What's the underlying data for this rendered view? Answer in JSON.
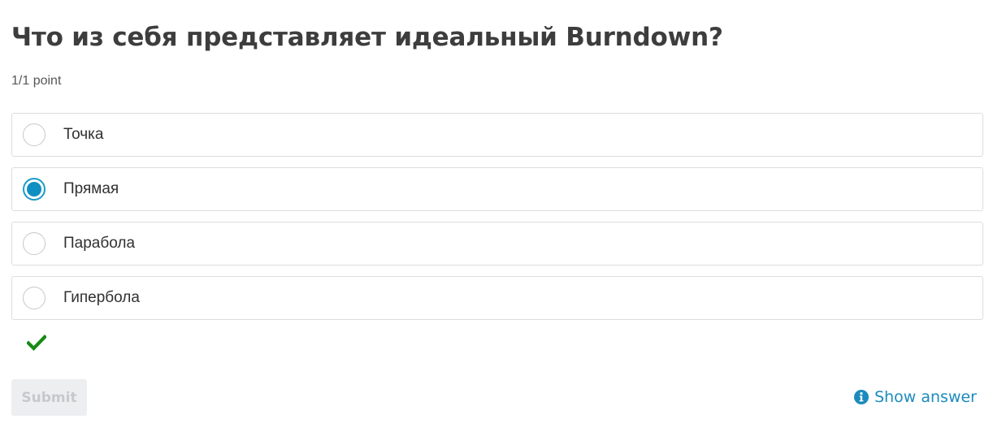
{
  "question": {
    "title": "Что из себя представляет идеальный Burndown?",
    "points": "1/1 point"
  },
  "options": [
    {
      "label": "Точка",
      "selected": false
    },
    {
      "label": "Прямая",
      "selected": true
    },
    {
      "label": "Парабола",
      "selected": false
    },
    {
      "label": "Гипербола",
      "selected": false
    }
  ],
  "feedback": {
    "icon": "checkmark-icon",
    "color": "#168a16"
  },
  "actions": {
    "submit_label": "Submit",
    "show_answer_label": "Show answer",
    "show_answer_icon": "info-icon"
  },
  "colors": {
    "accent": "#0f8fc2",
    "link": "#1b8bbd",
    "correct": "#168a16",
    "disabled_bg": "#eceef0",
    "disabled_text": "#c6c9cc"
  }
}
